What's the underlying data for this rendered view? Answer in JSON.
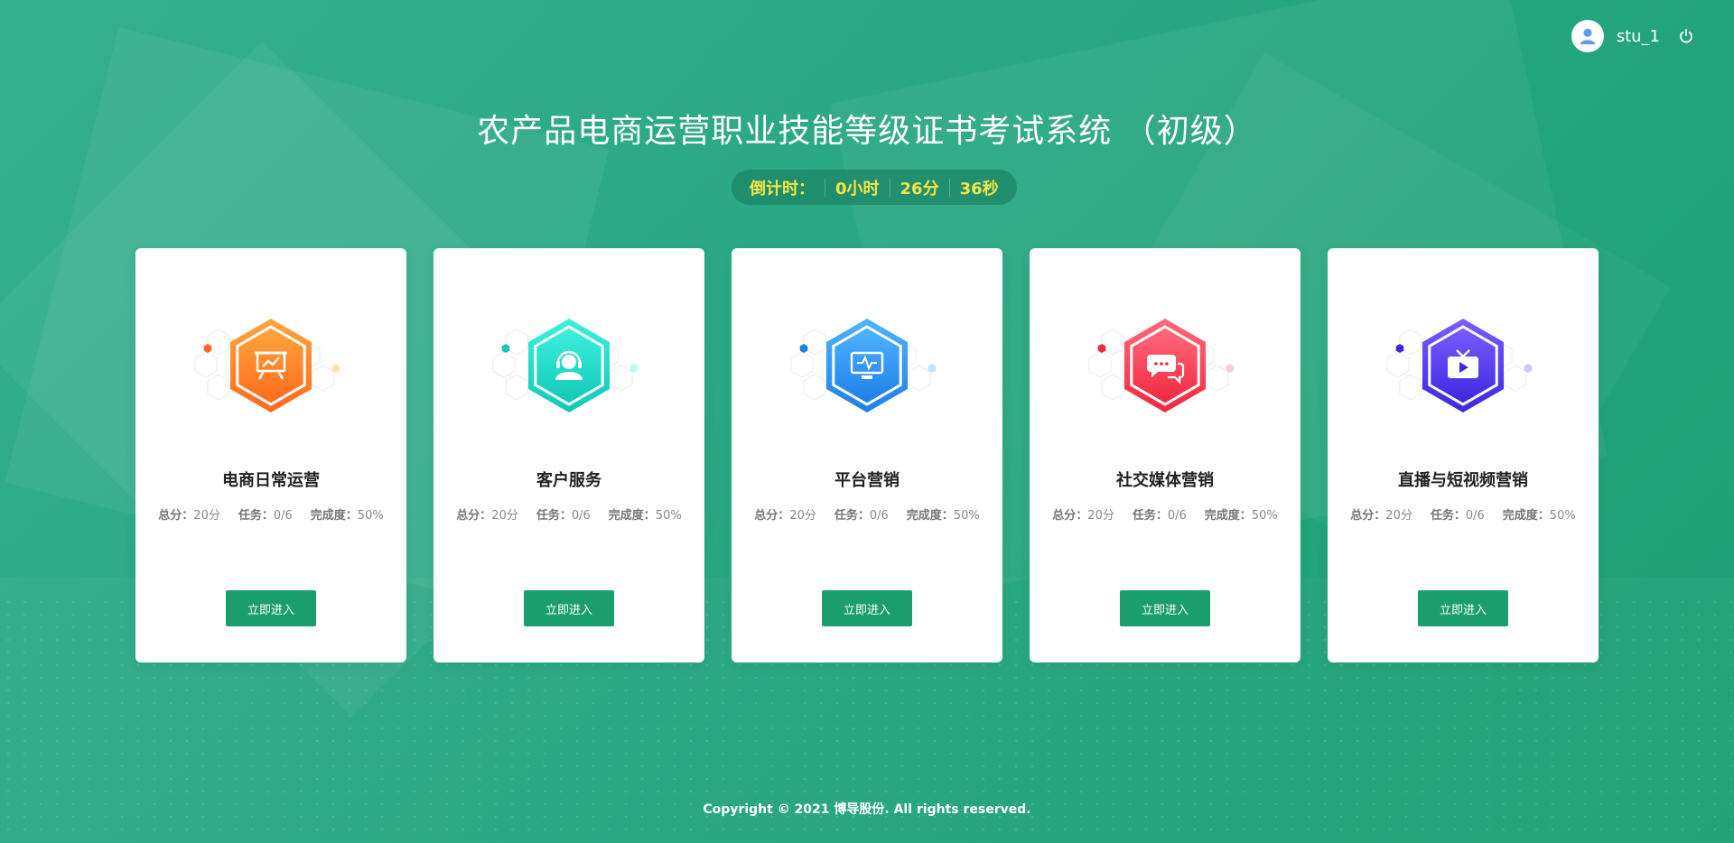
{
  "user": {
    "name": "stu_1"
  },
  "title": "农产品电商运营职业技能等级证书考试系统 （初级）",
  "countdown": {
    "label": "倒计时：",
    "hours": "0小时",
    "minutes": "26分",
    "seconds": "36秒"
  },
  "cards": [
    {
      "title": "电商日常运营",
      "score_label": "总分：",
      "score": "20分",
      "tasks_label": "任务：",
      "tasks": "0/6",
      "completion_label": "完成度：",
      "completion": "50%",
      "button": "立即进入",
      "icon": "presentation-chart-icon",
      "color_start": "#ffa63d",
      "color_end": "#ff6a1f"
    },
    {
      "title": "客户服务",
      "score_label": "总分：",
      "score": "20分",
      "tasks_label": "任务：",
      "tasks": "0/6",
      "completion_label": "完成度：",
      "completion": "50%",
      "button": "立即进入",
      "icon": "headset-user-icon",
      "color_start": "#3ef0dc",
      "color_end": "#12c8b8"
    },
    {
      "title": "平台营销",
      "score_label": "总分：",
      "score": "20分",
      "tasks_label": "任务：",
      "tasks": "0/6",
      "completion_label": "完成度：",
      "completion": "50%",
      "button": "立即进入",
      "icon": "monitor-pulse-icon",
      "color_start": "#4fb3ff",
      "color_end": "#1f7fe8"
    },
    {
      "title": "社交媒体营销",
      "score_label": "总分：",
      "score": "20分",
      "tasks_label": "任务：",
      "tasks": "0/6",
      "completion_label": "完成度：",
      "completion": "50%",
      "button": "立即进入",
      "icon": "chat-bubbles-icon",
      "color_start": "#ff6b7d",
      "color_end": "#f0283e"
    },
    {
      "title": "直播与短视频营销",
      "score_label": "总分：",
      "score": "20分",
      "tasks_label": "任务：",
      "tasks": "0/6",
      "completion_label": "完成度：",
      "completion": "50%",
      "button": "立即进入",
      "icon": "tv-play-icon",
      "color_start": "#7a5cff",
      "color_end": "#3d28e0"
    }
  ],
  "footer": "Copyright © 2021 博导股份. All rights reserved."
}
